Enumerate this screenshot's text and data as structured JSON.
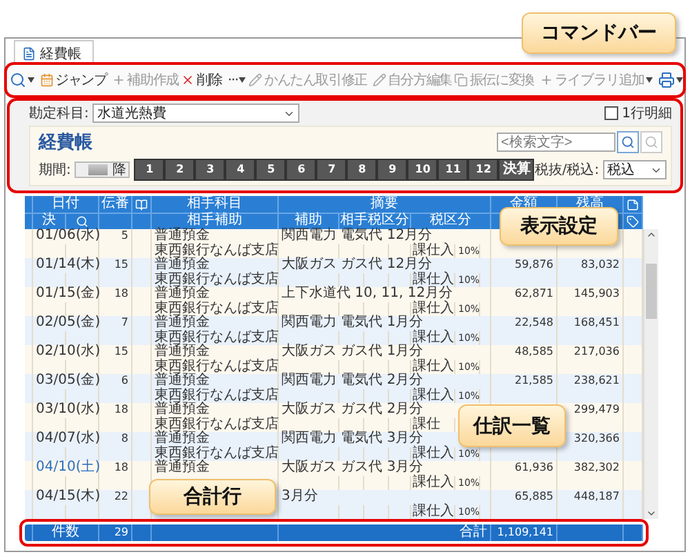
{
  "tab": {
    "label": "経費帳",
    "selected": true
  },
  "toolbar": {
    "left": [
      [
        {
          "kind": "search",
          "disabled": false,
          "caret": true
        }
      ],
      [
        {
          "kind": "jump",
          "label": "ジャンプ",
          "disabled": false,
          "caret": false
        }
      ],
      [
        {
          "kind": "add",
          "label": "補助作成",
          "disabled": true,
          "caret": false
        },
        {
          "kind": "delete",
          "label": "削除",
          "disabled": false,
          "caret": false
        }
      ],
      [
        {
          "kind": "more",
          "label": "···",
          "disabled": false,
          "caret": true
        }
      ]
    ],
    "right": [
      [
        {
          "kind": "edit",
          "label": "かんたん取引修正",
          "disabled": true,
          "caret": false
        }
      ],
      [
        {
          "kind": "edit",
          "label": "自分方編集",
          "disabled": true,
          "caret": false
        },
        {
          "kind": "convert",
          "label": "振伝に変換",
          "disabled": true,
          "caret": false
        }
      ],
      [
        {
          "kind": "add",
          "label": "ライブラリ追加",
          "disabled": true,
          "caret": true
        }
      ],
      [
        {
          "kind": "print",
          "disabled": false,
          "caret": true
        }
      ]
    ]
  },
  "account": {
    "label": "勘定科目:",
    "value": "水道光熱費"
  },
  "one_line": {
    "label": "1行明細",
    "checked": false
  },
  "ledger_title": "経費帳",
  "search": {
    "placeholder": "<検索文字>"
  },
  "period": {
    "label": "期間:",
    "range_text": "降",
    "months": [
      "1",
      "2",
      "3",
      "4",
      "5",
      "6",
      "7",
      "8",
      "9",
      "10",
      "11",
      "12",
      "決算"
    ]
  },
  "tax_mode": {
    "label": "税抜/税込:",
    "value": "税込"
  },
  "header": {
    "date": "日付",
    "closing": "決",
    "voucher": "伝番",
    "account": "相手科目",
    "sub_account": "相手補助",
    "summary": "摘要",
    "aux": "補助",
    "counter_tax": "相手税区分",
    "tax": "税区分",
    "amount": "金額",
    "balance": "残高"
  },
  "entries": [
    {
      "date": "01/06(水)",
      "weekend": false,
      "voucher": "5",
      "account": "普通預金",
      "sub_account": "東西銀行なんば支店",
      "summary": "関西電力 電気代 12月分",
      "tax": "課仕入",
      "rate": "10%"
    },
    {
      "date": "01/14(木)",
      "weekend": false,
      "voucher": "15",
      "account": "普通預金",
      "sub_account": "東西銀行なんば支店",
      "summary": "大阪ガス ガス代 12月分",
      "tax": "課仕入",
      "rate": "10%",
      "amount": "59,876",
      "balance": "83,032"
    },
    {
      "date": "01/15(金)",
      "weekend": false,
      "voucher": "18",
      "account": "普通預金",
      "sub_account": "東西銀行なんば支店",
      "summary": "上下水道代 10, 11, 12月分",
      "tax": "課仕入",
      "rate": "10%",
      "amount": "62,871",
      "balance": "145,903"
    },
    {
      "date": "02/05(金)",
      "weekend": false,
      "voucher": "7",
      "account": "普通預金",
      "sub_account": "東西銀行なんば支店",
      "summary": "関西電力 電気代 1月分",
      "tax": "課仕入",
      "rate": "10%",
      "amount": "22,548",
      "balance": "168,451"
    },
    {
      "date": "02/10(水)",
      "weekend": false,
      "voucher": "15",
      "account": "普通預金",
      "sub_account": "東西銀行なんば支店",
      "summary": "大阪ガス ガス代 1月分",
      "tax": "課仕入",
      "rate": "10%",
      "amount": "48,585",
      "balance": "217,036"
    },
    {
      "date": "03/05(金)",
      "weekend": false,
      "voucher": "6",
      "account": "普通預金",
      "sub_account": "東西銀行なんば支店",
      "summary": "関西電力 電気代 2月分",
      "tax": "課仕入",
      "rate": "10%",
      "amount": "21,585",
      "balance": "238,621"
    },
    {
      "date": "03/10(水)",
      "weekend": false,
      "voucher": "18",
      "account": "普通預金",
      "sub_account": "東西銀行なんば支店",
      "summary": "大阪ガス ガス代 2月分",
      "tax": "課仕",
      "balance": "299,479"
    },
    {
      "date": "04/07(水)",
      "weekend": false,
      "voucher": "8",
      "account": "普通預金",
      "sub_account": "東西銀行なんば支店",
      "summary": "関西電力 電気代 3月分",
      "tax": "課仕入",
      "rate": "10%",
      "balance": "320,366"
    },
    {
      "date": "04/10(土)",
      "weekend": true,
      "voucher": "18",
      "account": "普通預金",
      "summary": "大阪ガス ガス代 3月分",
      "tax": "課仕入",
      "rate": "10%",
      "amount": "61,936",
      "balance": "382,302"
    },
    {
      "date": "04/15(木)",
      "weekend": false,
      "voucher": "22",
      "summary": "3月分",
      "tax": "課仕入",
      "rate": "10%",
      "amount": "65,885",
      "balance": "448,187"
    }
  ],
  "total": {
    "count_label": "件数",
    "count": "29",
    "total_label": "合計",
    "total": "1,109,141"
  },
  "callouts": [
    {
      "label": "コマンドバー"
    },
    {
      "label": "表示設定"
    },
    {
      "label": "仕訳一覧"
    },
    {
      "label": "合計行"
    }
  ]
}
